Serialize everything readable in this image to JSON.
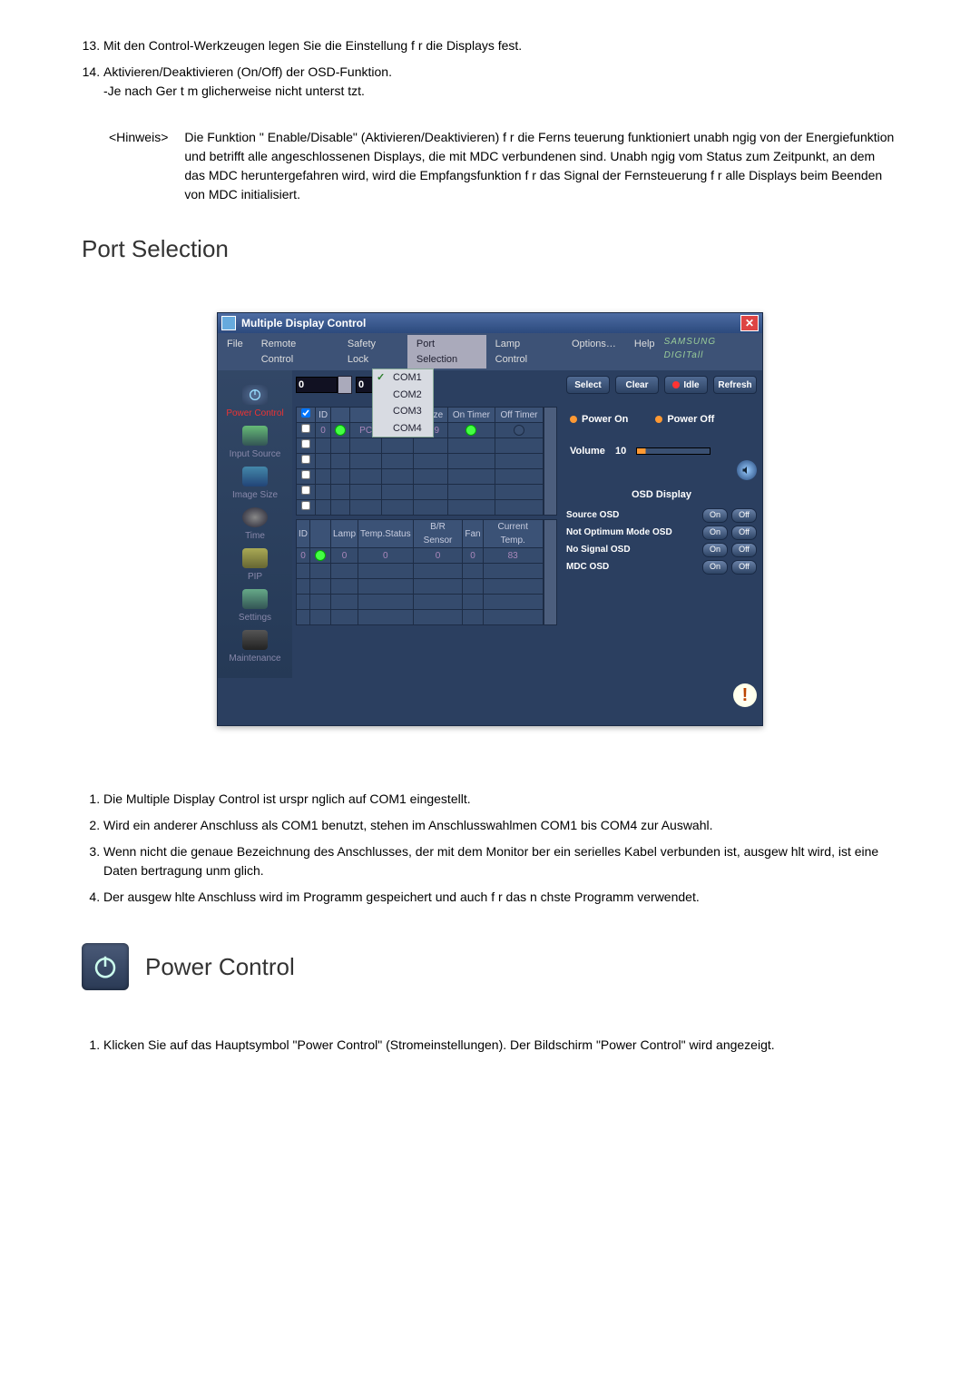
{
  "doc": {
    "list_start": 13,
    "items": [
      "Mit den Control-Werkzeugen legen Sie die Einstellung f r  die Displays fest.",
      "Aktivieren/Deaktivieren (On/Off) der OSD-Funktion.\n-Je nach Ger t m glicherweise nicht unterst tzt."
    ],
    "note_label": "<Hinweis>",
    "note_body": "Die Funktion \" Enable/Disable\" (Aktivieren/Deaktivieren) f r die Ferns teuerung funktioniert unabh ngig von der Energiefunktion und betrifft  alle angeschlossenen Displays, die mit MDC verbundenen sind. Unabh ngig vom Status zum Zeitpunkt, an dem das MDC heruntergefahren wird, wird die Empfangsfunktion f r das Signal der Fernsteuerung f r alle Displays beim Beenden von MDC initialisiert.",
    "section_heading": "Port Selection",
    "lower_list": [
      "Die Multiple Display Control ist urspr nglich auf COM1 eingestellt.",
      "Wird ein anderer Anschluss als COM1 benutzt, stehen im Anschlusswahlmen  COM1 bis COM4 zur Auswahl.",
      "Wenn nicht die genaue Bezeichnung des Anschlusses, der mit dem Monitor  ber ein serielles Kabel verbunden ist, ausgew hlt wird, ist eine  Daten bertragung unm glich.",
      "Der ausgew hlte Anschluss wird im Programm gespeichert und auch f r das n chste Programm verwendet."
    ],
    "power_heading": "Power Control",
    "power_list": [
      "Klicken Sie auf das Hauptsymbol \"Power Control\" (Stromeinstellungen). Der Bildschirm \"Power Control\" wird angezeigt."
    ]
  },
  "app": {
    "title": "Multiple Display Control",
    "brand": "SAMSUNG DIGITall",
    "menu": {
      "file": "File",
      "remote": "Remote Control",
      "safety": "Safety Lock",
      "port": "Port Selection",
      "lamp": "Lamp Control",
      "options": "Options…",
      "help": "Help"
    },
    "sidebar": {
      "power": "Power Control",
      "input": "Input Source",
      "image": "Image Size",
      "time": "Time",
      "pip": "PIP",
      "settings": "Settings",
      "maint": "Maintenance"
    },
    "ports": [
      "COM1",
      "COM2",
      "COM3",
      "COM4"
    ],
    "id_left": "0",
    "id_right": "0",
    "buttons": {
      "select": "Select",
      "clear": "Clear",
      "idle": "Idle",
      "refresh": "Refresh",
      "power_on": "Power On",
      "power_off": "Power Off"
    },
    "volume": {
      "label": "Volume",
      "value": "10"
    },
    "top_table": {
      "headers": [
        "",
        "ID",
        "",
        "",
        "",
        "e Size",
        "On Timer",
        "Off Timer"
      ],
      "row": {
        "id": "0",
        "input": "PC",
        "size": "16:9"
      }
    },
    "bottom_table": {
      "headers": [
        "ID",
        "",
        "Lamp",
        "Temp.Status",
        "B/R Sensor",
        "Fan",
        "Current Temp."
      ],
      "row": {
        "id": "0",
        "lamp": "0",
        "temp_status": "0",
        "br": "0",
        "fan": "0",
        "ctemp": "83"
      }
    },
    "osd": {
      "title": "OSD Display",
      "rows": [
        {
          "label": "Source OSD",
          "on": "On",
          "off": "Off"
        },
        {
          "label": "Not Optimum Mode OSD",
          "on": "On",
          "off": "Off"
        },
        {
          "label": "No Signal OSD",
          "on": "On",
          "off": "Off"
        },
        {
          "label": "MDC OSD",
          "on": "On",
          "off": "Off"
        }
      ]
    }
  }
}
